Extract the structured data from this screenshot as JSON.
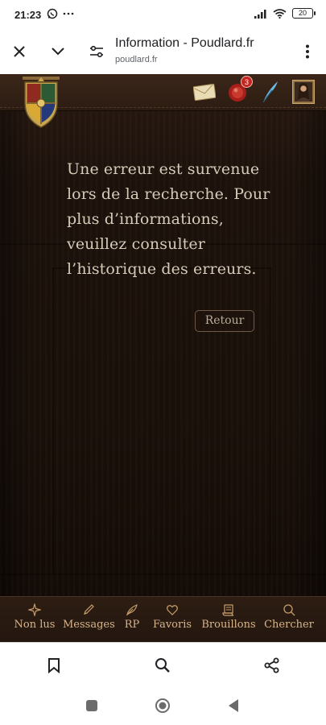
{
  "status_bar": {
    "time": "21:23",
    "battery": "20",
    "icons": [
      "whatsapp-icon",
      "more-dots-icon",
      "signal-icon",
      "wifi-icon",
      "battery-icon"
    ]
  },
  "browser": {
    "title": "Information - Poudlard.fr",
    "url": "poudlard.fr",
    "icons": [
      "close-icon",
      "chevron-down-icon",
      "site-settings-icon",
      "kebab-menu-icon"
    ]
  },
  "site_header": {
    "notification_count": "3",
    "icons": [
      "hogwarts-crest-icon",
      "envelope-icon",
      "red-seal-icon",
      "quill-icon",
      "avatar-portrait"
    ]
  },
  "error": {
    "message": "Une erreur est survenue lors de la recherche. Pour plus d’informations, veuillez consulter l’historique des erreurs.",
    "back_label": "Retour"
  },
  "site_nav": {
    "items": [
      {
        "label": "Non lus",
        "icon": "sparkle-icon"
      },
      {
        "label": "Messages",
        "icon": "pen-icon"
      },
      {
        "label": "RP",
        "icon": "feather-icon"
      },
      {
        "label": "Favoris",
        "icon": "heart-icon"
      },
      {
        "label": "Brouillons",
        "icon": "scroll-icon"
      },
      {
        "label": "Chercher",
        "icon": "search-icon"
      }
    ]
  },
  "chrome_bottom": {
    "icons": [
      "bookmark-icon",
      "search-icon",
      "share-icon"
    ]
  },
  "android_nav": {
    "icons": [
      "recents-icon",
      "home-icon",
      "back-icon"
    ]
  },
  "colors": {
    "site_bg": "#1c110b",
    "text": "#d6cbb8",
    "nav_accent": "#d7b58c"
  }
}
